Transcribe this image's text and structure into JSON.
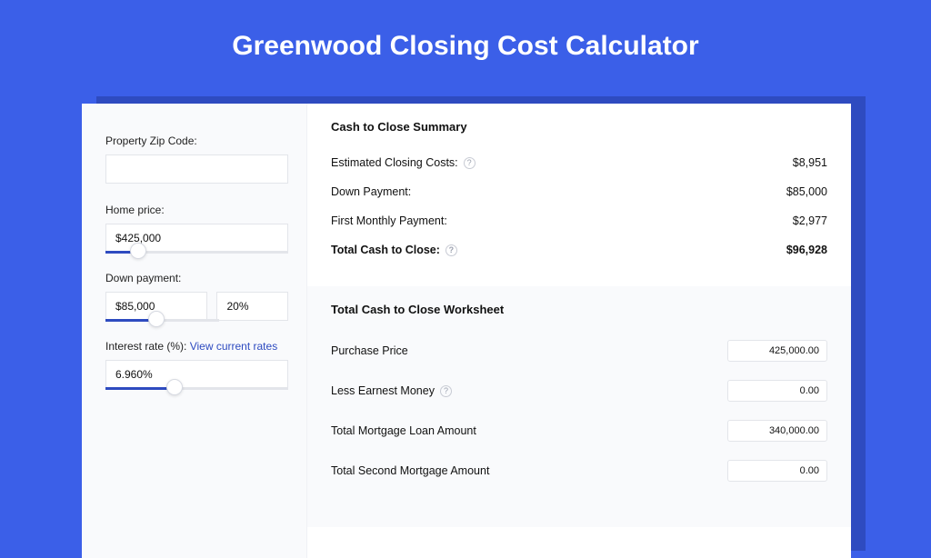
{
  "page": {
    "title": "Greenwood Closing Cost Calculator"
  },
  "inputs": {
    "zip_label": "Property Zip Code:",
    "zip_value": "",
    "home_price_label": "Home price:",
    "home_price_value": "$425,000",
    "down_payment_label": "Down payment:",
    "down_payment_value": "$85,000",
    "down_payment_pct": "20%",
    "interest_label": "Interest rate (%): ",
    "interest_link": "View current rates",
    "interest_value": "6.960%"
  },
  "summary": {
    "title": "Cash to Close Summary",
    "rows": [
      {
        "label": "Estimated Closing Costs:",
        "help": true,
        "value": "$8,951",
        "bold": false
      },
      {
        "label": "Down Payment:",
        "help": false,
        "value": "$85,000",
        "bold": false
      },
      {
        "label": "First Monthly Payment:",
        "help": false,
        "value": "$2,977",
        "bold": false
      },
      {
        "label": "Total Cash to Close:",
        "help": true,
        "value": "$96,928",
        "bold": true
      }
    ]
  },
  "worksheet": {
    "title": "Total Cash to Close Worksheet",
    "rows": [
      {
        "label": "Purchase Price",
        "help": false,
        "value": "425,000.00"
      },
      {
        "label": "Less Earnest Money",
        "help": true,
        "value": "0.00"
      },
      {
        "label": "Total Mortgage Loan Amount",
        "help": false,
        "value": "340,000.00"
      },
      {
        "label": "Total Second Mortgage Amount",
        "help": false,
        "value": "0.00"
      }
    ]
  }
}
